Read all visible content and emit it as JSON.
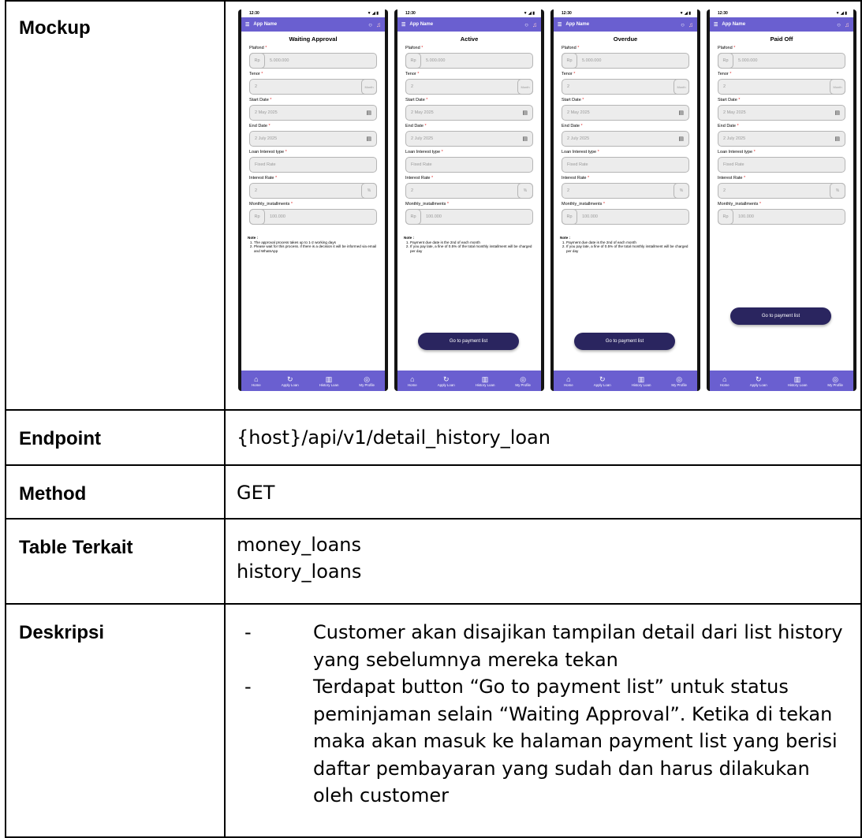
{
  "labels": {
    "mockup": "Mockup",
    "endpoint": "Endpoint",
    "method": "Method",
    "table": "Table Terkait",
    "deskripsi": "Deskripsi"
  },
  "endpoint": "{host}/api/v1/detail_history_loan",
  "method": "GET",
  "tables": [
    "money_loans",
    "history_loans"
  ],
  "deskripsi": [
    "Customer akan disajikan tampilan detail dari list history yang sebelumnya mereka tekan",
    "Terdapat button “Go to payment list” untuk status peminjaman selain “Waiting Approval”. Ketika di tekan maka akan masuk ke halaman payment list yang berisi daftar pembayaran yang sudah dan harus dilakukan oleh customer"
  ],
  "bullet_mark": "-",
  "phone": {
    "time": "12:30",
    "status_icons": "▼ ◢ ▮",
    "app_name": "App Name",
    "accent": "#6a5fd0",
    "button_color": "#2a255f",
    "fields": {
      "plafond": "Plafond",
      "tenor": "Tenor",
      "start_date": "Start Date",
      "end_date": "End Date",
      "loan_interest_type": "Loan Interest type",
      "interest_rate": "Interest Rate",
      "monthly": "Monthly_installments"
    },
    "required_mark": "*",
    "values": {
      "rp": "Rp",
      "plafond": "5.000.000",
      "tenor": "2",
      "tenor_unit": "Month",
      "start_date": "2 May 2025",
      "end_date": "2 July 2025",
      "interest_type": "Fixed Rate",
      "interest_rate": "2",
      "pct": "%",
      "monthly": "100.000"
    },
    "note_title": "Note :",
    "go_button": "Go to payment list",
    "nav": [
      "Home",
      "Apply Loan",
      "History Loan",
      "My Profile"
    ],
    "screens": [
      {
        "status": "Waiting Approval",
        "notes": [
          "The approval process takes up to 1-2 working days",
          "Please wait for this process. if there is a decision it will be informed via email and WhatsApp"
        ]
      },
      {
        "status": "Active",
        "notes": [
          "Payment due date is the 2nd of each month",
          "If you pay late, a fine of 0.5% of the total monthly installment will be charged per day"
        ]
      },
      {
        "status": "Overdue",
        "notes": [
          "Payment due date is the 2nd of each month",
          "If you pay late, a fine of 0.5% of the total monthly installment will be charged per day"
        ]
      },
      {
        "status": "Paid Off",
        "notes": []
      }
    ]
  }
}
